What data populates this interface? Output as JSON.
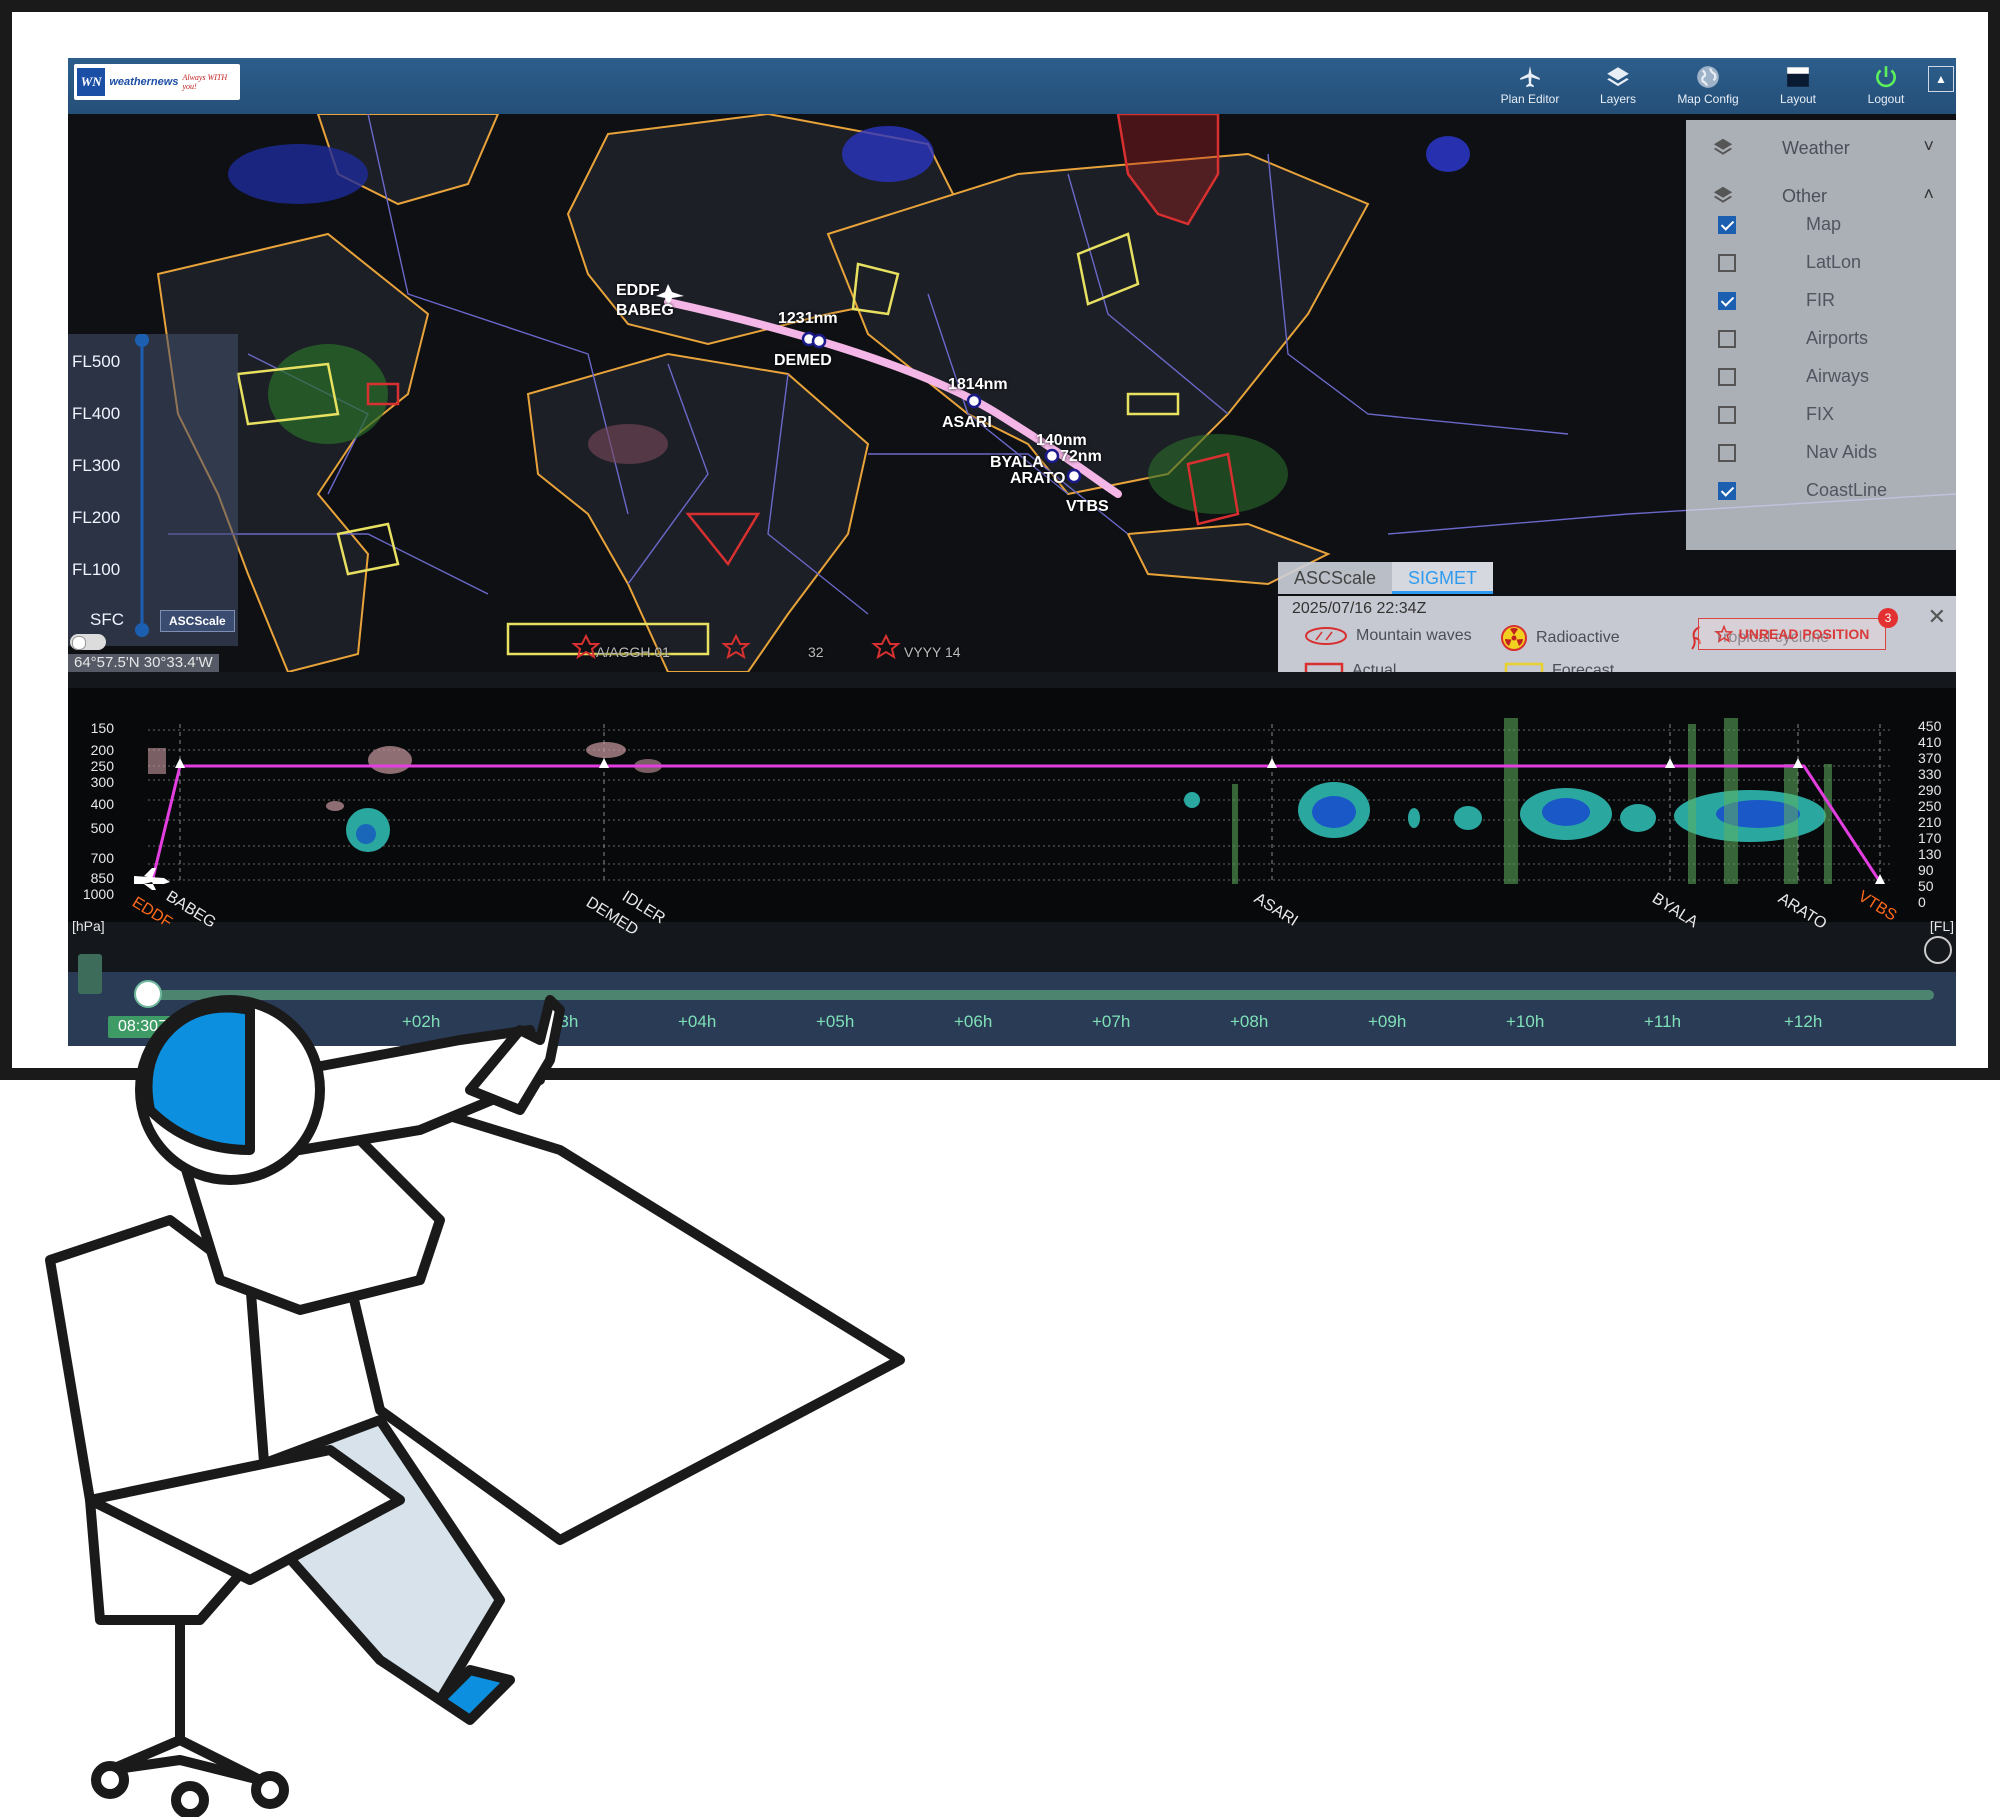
{
  "header": {
    "logo_brand": "weathernews",
    "logo_tagline": "Always WITH you!",
    "logo_mark": "WN",
    "nav": [
      {
        "label": "Plan Editor",
        "icon": "airplane-icon"
      },
      {
        "label": "Layers",
        "icon": "layers-icon"
      },
      {
        "label": "Map Config",
        "icon": "globe-icon"
      },
      {
        "label": "Layout",
        "icon": "layout-icon"
      },
      {
        "label": "Logout",
        "icon": "power-icon"
      }
    ]
  },
  "map": {
    "waypoints": [
      "EDDF",
      "BABEG",
      "DEMED",
      "ASARI",
      "BYALA",
      "ARATO",
      "VTBS"
    ],
    "distances": [
      "1231nm",
      "1814nm",
      "140nm",
      "72nm"
    ],
    "flight_levels": [
      "FL500",
      "FL400",
      "FL300",
      "FL200",
      "FL100",
      "SFC"
    ],
    "asc_chip": "ASCScale",
    "coordinate": "64°57.5'N 30°33.4'W",
    "map_labels": [
      "A/AGGH 01",
      "VYYY 14",
      "32"
    ]
  },
  "layers_panel": {
    "groups": [
      {
        "label": "Weather",
        "chevron": "˅"
      },
      {
        "label": "Other",
        "chevron": "˄"
      }
    ],
    "items": [
      {
        "label": "Map",
        "checked": true
      },
      {
        "label": "LatLon",
        "checked": false
      },
      {
        "label": "FIR",
        "checked": true
      },
      {
        "label": "Airports",
        "checked": false
      },
      {
        "label": "Airways",
        "checked": false
      },
      {
        "label": "FIX",
        "checked": false
      },
      {
        "label": "Nav Aids",
        "checked": false
      },
      {
        "label": "CoastLine",
        "checked": true
      }
    ]
  },
  "sigmet": {
    "tabs": [
      "ASCScale",
      "SIGMET"
    ],
    "active_tab": "SIGMET",
    "datetime": "2025/07/16 22:34Z",
    "legend": {
      "mountain_waves": "Mountain waves",
      "radioactive": "Radioactive",
      "tropical_cyclone": "Tropical cyclone",
      "actual": "Actual",
      "forecast": "Forecast"
    },
    "unread_label": "UNREAD POSITION",
    "unread_count": "3",
    "close": "✕"
  },
  "profile": {
    "hpa_ticks": [
      "150",
      "200",
      "250",
      "300",
      "400",
      "500",
      "700",
      "850",
      "1000"
    ],
    "hpa_unit": "[hPa]",
    "fl_ticks": [
      "450",
      "410",
      "370",
      "330",
      "290",
      "250",
      "210",
      "170",
      "130",
      "90",
      "50",
      "0"
    ],
    "fl_unit": "[FL]",
    "waypoints": [
      {
        "name": "EDDF",
        "orange": true
      },
      {
        "name": "BABEG",
        "orange": false
      },
      {
        "name": "DEMED",
        "orange": false
      },
      {
        "name": "IDLER",
        "orange": false
      },
      {
        "name": "ASARI",
        "orange": false
      },
      {
        "name": "BYALA",
        "orange": false
      },
      {
        "name": "ARATO",
        "orange": false
      },
      {
        "name": "VTBS",
        "orange": true
      }
    ]
  },
  "timeline": {
    "current": "08:30Z",
    "ticks": [
      "+02h",
      "+03h",
      "+04h",
      "+05h",
      "+06h",
      "+07h",
      "+08h",
      "+09h",
      "+10h",
      "+11h",
      "+12h"
    ],
    "progress": 0.0
  },
  "colors": {
    "route": "#f3b6e6",
    "profile_route": "#e23ee0",
    "accent": "#2e9bf0",
    "timeline_accent": "#3f9b66"
  }
}
